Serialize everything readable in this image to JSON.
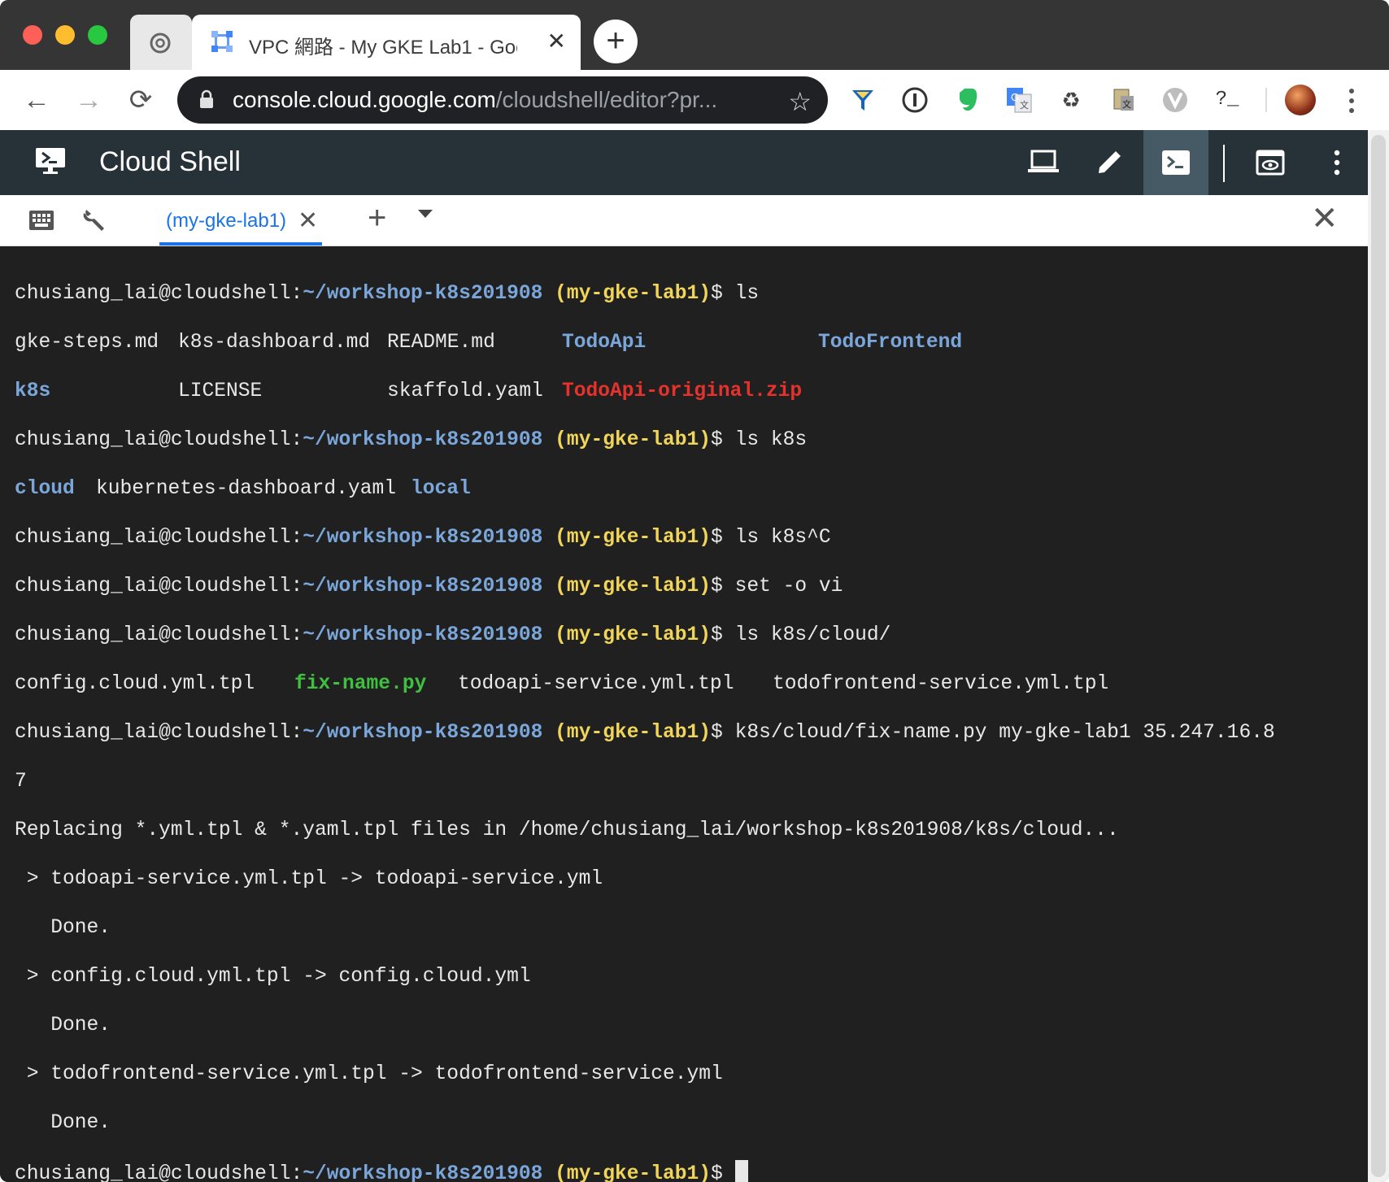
{
  "browser": {
    "tab_title": "VPC 網路 - My GKE Lab1 - Goo",
    "url_host": "console.cloud.google.com",
    "url_path": "/cloudshell/editor?pr...",
    "terminal_ext_label": "?_"
  },
  "cloud_shell": {
    "title": "Cloud Shell",
    "tab_label": "(my-gke-lab1)",
    "accent": "#1a73e8",
    "header_color": "#263238"
  },
  "terminal": {
    "prompt_user": "chusiang_lai@cloudshell:",
    "prompt_path": "~/workshop-k8s201908",
    "prompt_project": "(my-gke-lab1)",
    "prompt_symbol": "$ ",
    "cmd_ls": "ls",
    "ls_row1": [
      "gke-steps.md",
      "k8s-dashboard.md",
      "README.md",
      "TodoApi",
      "TodoFrontend"
    ],
    "ls_row2": [
      "k8s",
      "LICENSE",
      "skaffold.yaml",
      "TodoApi-original.zip"
    ],
    "cmd_ls_k8s": "ls k8s",
    "k8s_row": [
      "cloud",
      "kubernetes-dashboard.yaml",
      "local"
    ],
    "cmd_ls_k8s_c": "ls k8s^C",
    "cmd_set_vi": "set -o vi",
    "cmd_ls_cloud": "ls k8s/cloud/",
    "cloud_row": [
      "config.cloud.yml.tpl",
      "fix-name.py",
      "todoapi-service.yml.tpl",
      "todofrontend-service.yml.tpl"
    ],
    "cmd_fix_name": "k8s/cloud/fix-name.py my-gke-lab1 35.247.16.8",
    "cmd_fix_name_wrap": "7",
    "output_replacing": "Replacing *.yml.tpl & *.yaml.tpl files in /home/chusiang_lai/workshop-k8s201908/k8s/cloud...",
    "output_1": " > todoapi-service.yml.tpl -> todoapi-service.yml",
    "output_done": "   Done.",
    "output_2": " > config.cloud.yml.tpl -> config.cloud.yml",
    "output_3": " > todofrontend-service.yml.tpl -> todofrontend-service.yml"
  },
  "colors": {
    "dir": "#7aa6da",
    "project": "#f0d55a",
    "zip": "#e5322d",
    "exec": "#40c040"
  },
  "icons": {
    "ext1": "funnel-icon",
    "ext2": "1password-icon",
    "ext3": "evernote-icon",
    "ext4": "google-translate-icon",
    "ext5": "recycle-icon",
    "ext6": "dictionary-icon",
    "ext7": "vivaldi-icon"
  }
}
